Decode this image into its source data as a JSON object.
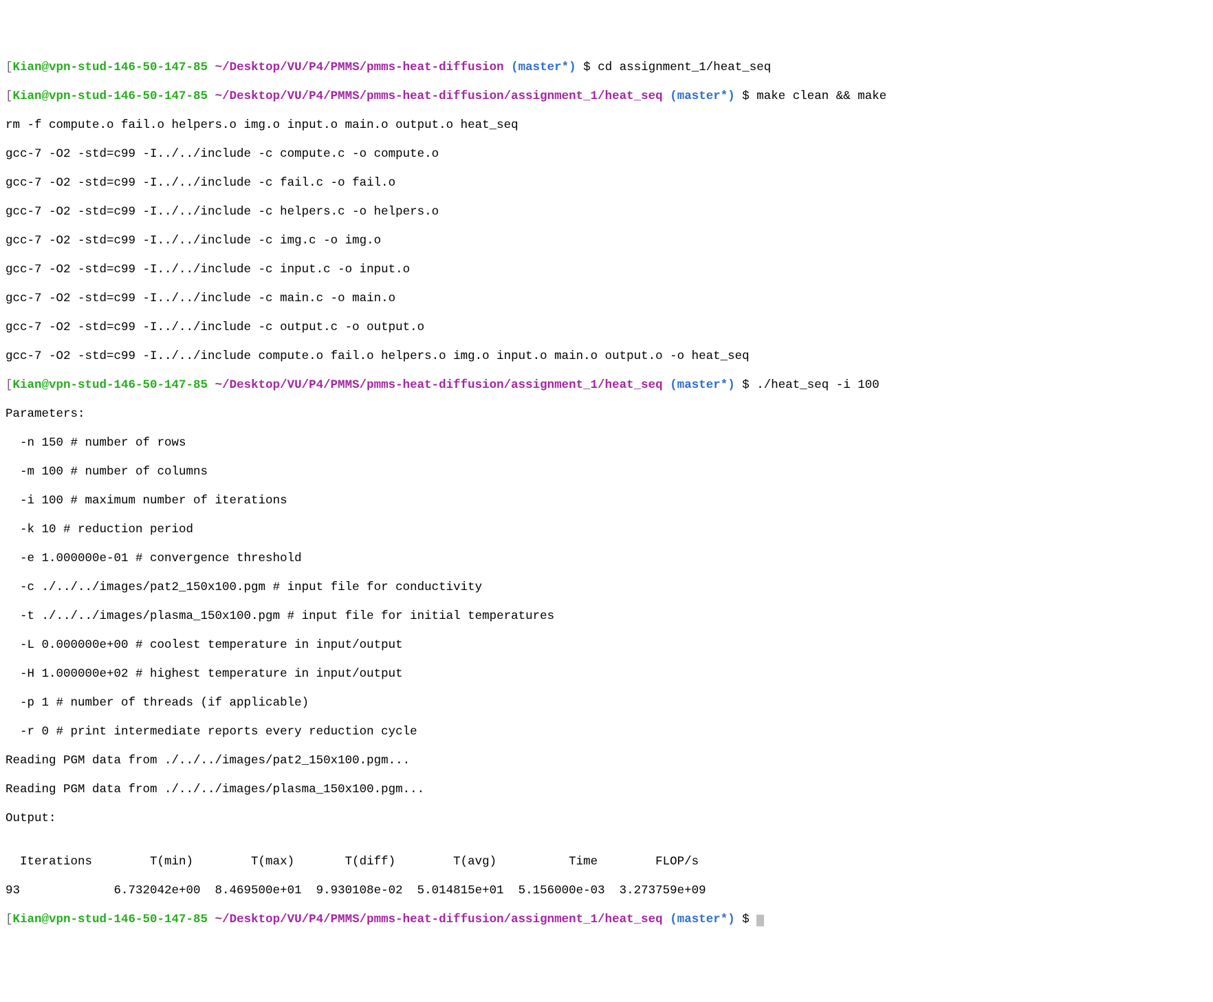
{
  "prompts": [
    {
      "user_host": "Kian@vpn-stud-146-50-147-85",
      "path": "~/Desktop/VU/P4/PMMS/pmms-heat-diffusion",
      "branch": "(master*)",
      "dollar": " $ ",
      "command": "cd assignment_1/heat_seq"
    },
    {
      "user_host": "Kian@vpn-stud-146-50-147-85",
      "path": "~/Desktop/VU/P4/PMMS/pmms-heat-diffusion/assignment_1/heat_seq",
      "branch": "(master*)",
      "dollar": " $ ",
      "command": "make clean && make"
    },
    {
      "user_host": "Kian@vpn-stud-146-50-147-85",
      "path": "~/Desktop/VU/P4/PMMS/pmms-heat-diffusion/assignment_1/heat_seq",
      "branch": "(master*)",
      "dollar": " $ ",
      "command": "./heat_seq -i 100"
    },
    {
      "user_host": "Kian@vpn-stud-146-50-147-85",
      "path": "~/Desktop/VU/P4/PMMS/pmms-heat-diffusion/assignment_1/heat_seq",
      "branch": "(master*)",
      "dollar": " $ ",
      "command": ""
    }
  ],
  "make_output": [
    "rm -f compute.o fail.o helpers.o img.o input.o main.o output.o heat_seq",
    "gcc-7 -O2 -std=c99 -I../../include -c compute.c -o compute.o",
    "gcc-7 -O2 -std=c99 -I../../include -c fail.c -o fail.o",
    "gcc-7 -O2 -std=c99 -I../../include -c helpers.c -o helpers.o",
    "gcc-7 -O2 -std=c99 -I../../include -c img.c -o img.o",
    "gcc-7 -O2 -std=c99 -I../../include -c input.c -o input.o",
    "gcc-7 -O2 -std=c99 -I../../include -c main.c -o main.o",
    "gcc-7 -O2 -std=c99 -I../../include -c output.c -o output.o",
    "gcc-7 -O2 -std=c99 -I../../include compute.o fail.o helpers.o img.o input.o main.o output.o -o heat_seq"
  ],
  "params_header": "Parameters:",
  "params": [
    "  -n 150 # number of rows",
    "  -m 100 # number of columns",
    "  -i 100 # maximum number of iterations",
    "  -k 10 # reduction period",
    "  -e 1.000000e-01 # convergence threshold",
    "  -c ./../../images/pat2_150x100.pgm # input file for conductivity",
    "  -t ./../../images/plasma_150x100.pgm # input file for initial temperatures",
    "  -L 0.000000e+00 # coolest temperature in input/output",
    "  -H 1.000000e+02 # highest temperature in input/output",
    "  -p 1 # number of threads (if applicable)",
    "  -r 0 # print intermediate reports every reduction cycle"
  ],
  "reading": [
    "Reading PGM data from ./../../images/pat2_150x100.pgm...",
    "Reading PGM data from ./../../images/plasma_150x100.pgm..."
  ],
  "output_header": "Output:",
  "blank": "",
  "table_header": "  Iterations        T(min)        T(max)       T(diff)        T(avg)          Time        FLOP/s",
  "table_row": "93             6.732042e+00  8.469500e+01  9.930108e-02  5.014815e+01  5.156000e-03  3.273759e+09",
  "bracket_open": "[",
  "bracket_close": "]"
}
